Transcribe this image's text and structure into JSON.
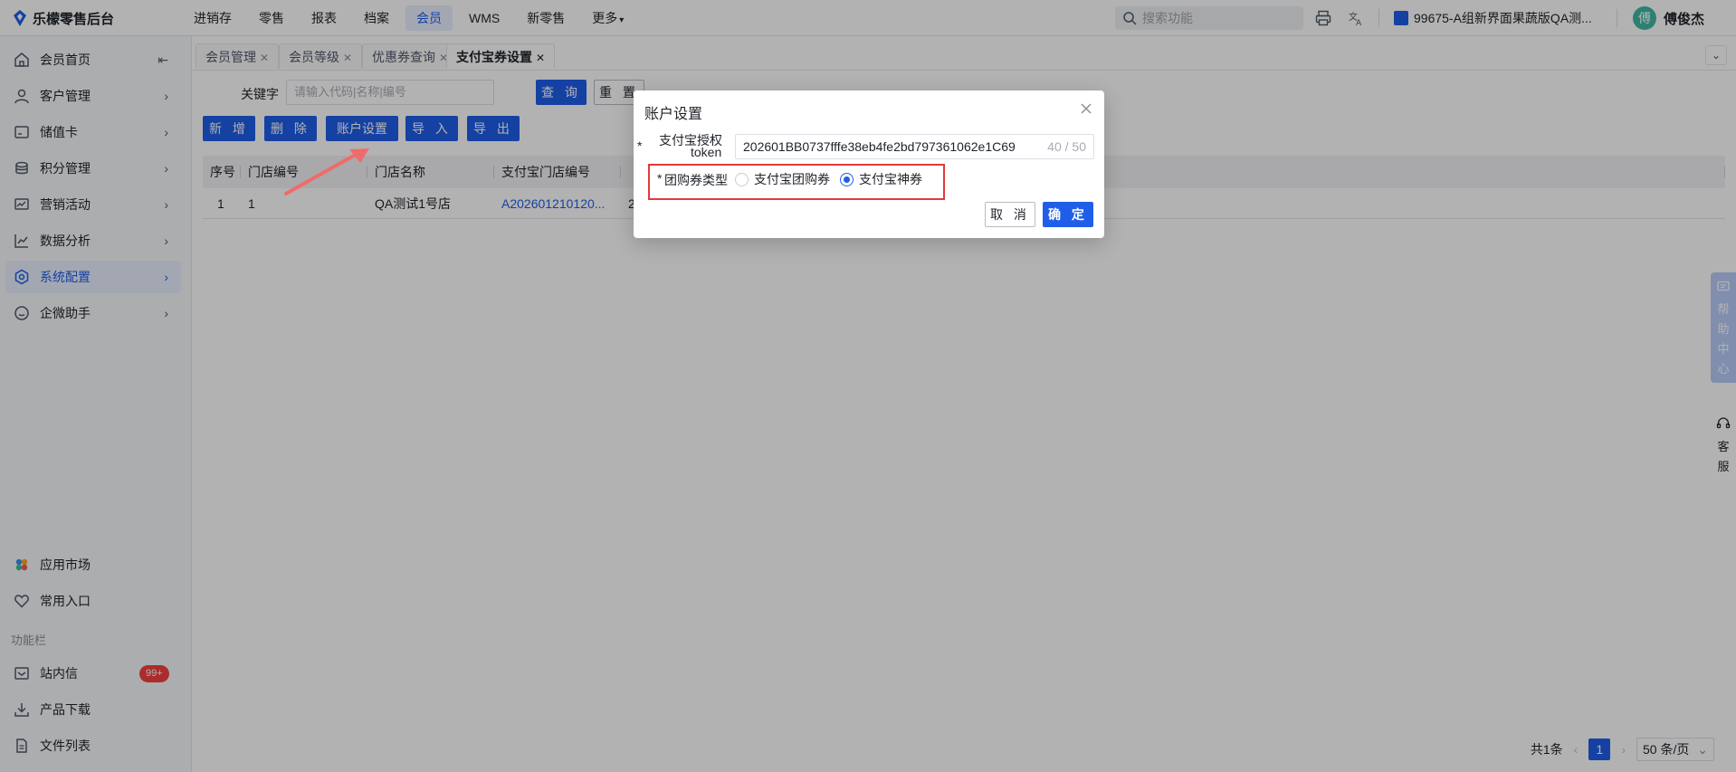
{
  "app": {
    "title": "乐檬零售后台"
  },
  "topnav": {
    "items": [
      {
        "label": "进销存"
      },
      {
        "label": "零售"
      },
      {
        "label": "报表"
      },
      {
        "label": "档案"
      },
      {
        "label": "会员"
      },
      {
        "label": "WMS"
      },
      {
        "label": "新零售"
      },
      {
        "label": "更多"
      }
    ],
    "active_index": 4,
    "search_placeholder": "搜索功能",
    "store": "99675-A组新界面果蔬版QA测...",
    "user": {
      "name": "傅俊杰",
      "avatar_char": "傅"
    }
  },
  "sidebar": {
    "items": [
      {
        "label": "会员首页",
        "icon": "home-icon"
      },
      {
        "label": "客户管理",
        "icon": "user-icon"
      },
      {
        "label": "储值卡",
        "icon": "card-icon"
      },
      {
        "label": "积分管理",
        "icon": "coins-icon"
      },
      {
        "label": "营销活动",
        "icon": "campaign-icon"
      },
      {
        "label": "数据分析",
        "icon": "chart-icon"
      },
      {
        "label": "系统配置",
        "icon": "settings-icon"
      },
      {
        "label": "企微助手",
        "icon": "chat-icon"
      }
    ],
    "active_index": 6,
    "bottom": {
      "app_market": "应用市场",
      "favorites": "常用入口",
      "group_label": "功能栏",
      "messages": "站内信",
      "messages_badge": "99+",
      "download": "产品下载",
      "files": "文件列表"
    }
  },
  "tabs": [
    {
      "label": "会员管理"
    },
    {
      "label": "会员等级"
    },
    {
      "label": "优惠券查询"
    },
    {
      "label": "支付宝券设置"
    }
  ],
  "active_tab": 3,
  "filter": {
    "keyword_label": "关键字",
    "keyword_placeholder": "请输入代码|名称|编号",
    "query_label": "查 询",
    "reset_label": "重 置"
  },
  "toolbar": {
    "add": "新 增",
    "delete": "删 除",
    "account_settings": "账户设置",
    "import": "导 入",
    "export": "导 出"
  },
  "table": {
    "columns": [
      "序号",
      "门店编号",
      "门店名称",
      "支付宝门店编号"
    ],
    "rows": [
      [
        "1",
        "1",
        "QA测试1号店",
        "A202601210120...",
        "2"
      ]
    ]
  },
  "pagination": {
    "total": "共1条",
    "current_page": "1",
    "page_size": "50 条/页"
  },
  "float": {
    "help": [
      "帮",
      "助",
      "中",
      "心"
    ],
    "service": [
      "客",
      "服"
    ]
  },
  "modal": {
    "title": "账户设置",
    "token_label_line1": "支付宝授权",
    "token_label_line2": "token",
    "token_value": "202601BB0737fffe38eb4fe2bd797361062e1C69",
    "token_count": "40 / 50",
    "coupon_type_label": "团购券类型",
    "options": [
      "支付宝团购券",
      "支付宝神券"
    ],
    "selected_index": 1,
    "cancel": "取 消",
    "confirm": "确 定",
    "required_mark": "*"
  },
  "colors": {
    "primary": "#1f5ee8",
    "danger": "#f53f3f",
    "annotation": "#e4393c"
  }
}
